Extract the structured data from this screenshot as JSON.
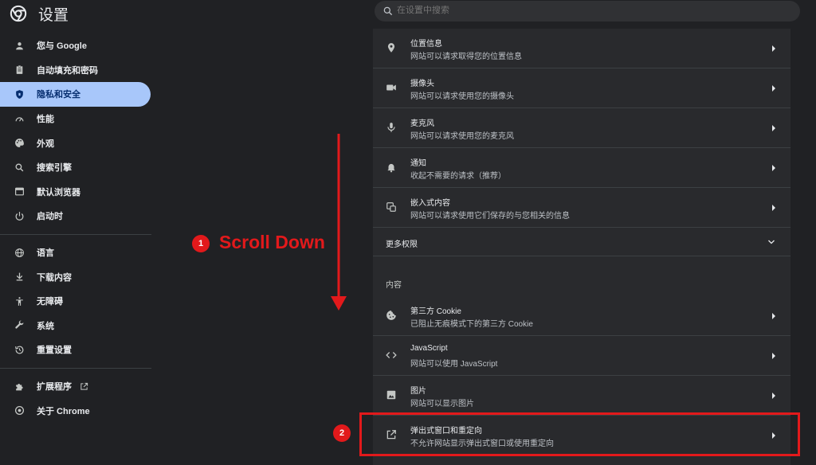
{
  "header": {
    "title": "设置",
    "logo_icon": "chrome-logo-icon",
    "search_placeholder": "在设置中搜索"
  },
  "sidebar": {
    "groups": [
      [
        {
          "label": "您与 Google",
          "icon": "person-icon"
        },
        {
          "label": "自动填充和密码",
          "icon": "clipboard-icon"
        },
        {
          "label": "隐私和安全",
          "icon": "shield-icon",
          "active": true
        },
        {
          "label": "性能",
          "icon": "speedometer-icon"
        },
        {
          "label": "外观",
          "icon": "palette-icon"
        },
        {
          "label": "搜索引擎",
          "icon": "search-icon"
        },
        {
          "label": "默认浏览器",
          "icon": "browser-icon"
        },
        {
          "label": "启动时",
          "icon": "power-icon"
        }
      ],
      [
        {
          "label": "语言",
          "icon": "globe-icon"
        },
        {
          "label": "下载内容",
          "icon": "download-icon"
        },
        {
          "label": "无障碍",
          "icon": "accessibility-icon"
        },
        {
          "label": "系统",
          "icon": "wrench-icon"
        },
        {
          "label": "重置设置",
          "icon": "history-icon"
        }
      ],
      [
        {
          "label": "扩展程序",
          "icon": "puzzle-icon",
          "external": true
        },
        {
          "label": "关于 Chrome",
          "icon": "chrome-icon"
        }
      ]
    ]
  },
  "main": {
    "permissions": [
      {
        "title": "位置信息",
        "subtitle": "网站可以请求取得您的位置信息",
        "icon": "location-pin-icon"
      },
      {
        "title": "摄像头",
        "subtitle": "网站可以请求使用您的摄像头",
        "icon": "camera-icon"
      },
      {
        "title": "麦克风",
        "subtitle": "网站可以请求使用您的麦克风",
        "icon": "microphone-icon"
      },
      {
        "title": "通知",
        "subtitle": "收起不需要的请求（推荐）",
        "icon": "bell-icon"
      },
      {
        "title": "嵌入式内容",
        "subtitle": "网站可以请求使用它们保存的与您相关的信息",
        "icon": "embedded-content-icon"
      }
    ],
    "more_permissions": "更多权限",
    "content_section": "内容",
    "content": [
      {
        "title": "第三方 Cookie",
        "subtitle": "已阻止无痕模式下的第三方 Cookie",
        "icon": "cookie-icon"
      },
      {
        "title": "JavaScript",
        "subtitle": "网站可以使用 JavaScript",
        "icon": "code-icon"
      },
      {
        "title": "图片",
        "subtitle": "网站可以显示图片",
        "icon": "image-icon"
      },
      {
        "title": "弹出式窗口和重定向",
        "subtitle": "不允许网站显示弹出式窗口或使用重定向",
        "icon": "popout-icon"
      }
    ]
  },
  "annotations": {
    "step1_number": "1",
    "step1_text": "Scroll Down",
    "step2_number": "2",
    "color": "#e2191b"
  },
  "colors": {
    "background": "#202124",
    "card": "#292a2d",
    "active_nav": "#a8c7fa"
  }
}
